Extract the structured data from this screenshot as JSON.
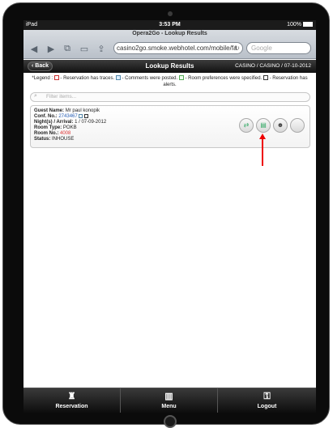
{
  "status_bar": {
    "device": "iPad",
    "time": "3:53 PM",
    "battery": "100%"
  },
  "browser": {
    "page_title": "Opera2Go - Lookup Results",
    "url": "casino2go.smoke.webhotel.com/mobile/fa",
    "search_placeholder": "Google"
  },
  "header": {
    "back_label": "Back",
    "title": "Lookup Results",
    "context": "CASINO / CASINO / 07-10-2012"
  },
  "legend": {
    "prefix": "*Legend :",
    "traces": "- Reservation has traces.",
    "comments": "- Comments were posted.",
    "prefs": "- Room preferences were specified.",
    "alerts": "- Reservation has alerts."
  },
  "filter": {
    "placeholder": "Filter items..."
  },
  "reservation": {
    "guest_label": "Guest Name:",
    "guest_value": "Mr paul konopik",
    "conf_label": "Conf. No.:",
    "conf_value": "2743467",
    "nights_label": "Night(s) / Arrival:",
    "nights_value": "1 / 07-09-2012",
    "room_type_label": "Room Type:",
    "room_type_value": "POKB",
    "room_no_label": "Room No.:",
    "room_no_value": "4008",
    "status_label": "Status:",
    "status_value": "INHOUSE"
  },
  "actions": [
    {
      "icon": "checkout-icon"
    },
    {
      "icon": "folio-icon"
    },
    {
      "icon": "guest-profile-icon"
    },
    {
      "icon": "blank-icon"
    }
  ],
  "tabs": [
    {
      "label": "Reservation",
      "icon": "reservation-icon"
    },
    {
      "label": "Menu",
      "icon": "menu-icon"
    },
    {
      "label": "Logout",
      "icon": "logout-icon"
    }
  ],
  "colors": {
    "link": "#2a62b8",
    "highlight": "#d33333",
    "annotation_arrow": "#e00000"
  }
}
